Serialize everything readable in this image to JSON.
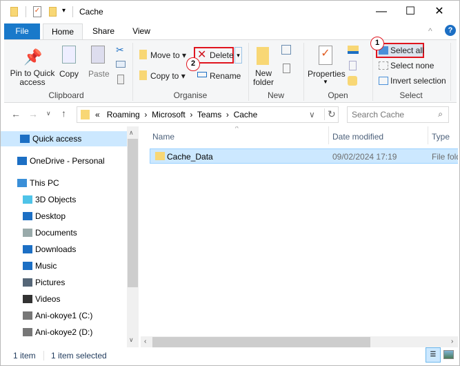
{
  "window": {
    "title": "Cache",
    "controls": [
      "minimize",
      "maximize",
      "close"
    ]
  },
  "tabs": [
    {
      "label": "File"
    },
    {
      "label": "Home"
    },
    {
      "label": "Share"
    },
    {
      "label": "View"
    }
  ],
  "ribbon": {
    "clipboard": {
      "label": "Clipboard",
      "pin": "Pin to Quick access",
      "copy": "Copy",
      "paste": "Paste"
    },
    "organise": {
      "label": "Organise",
      "move_to": "Move to",
      "copy_to": "Copy to",
      "delete": "Delete",
      "rename": "Rename"
    },
    "new": {
      "label": "New",
      "new_folder": "New folder"
    },
    "open": {
      "label": "Open",
      "properties": "Properties"
    },
    "select": {
      "label": "Select",
      "select_all": "Select all",
      "select_none": "Select none",
      "invert": "Invert selection"
    }
  },
  "annotations": [
    {
      "n": "1",
      "target": "Select all"
    },
    {
      "n": "2",
      "target": "Delete"
    }
  ],
  "address": {
    "breadcrumb": [
      "«",
      "Roaming",
      "Microsoft",
      "Teams",
      "Cache"
    ],
    "search_placeholder": "Search Cache"
  },
  "sidebar": {
    "items": [
      {
        "label": "Quick access",
        "icon": "star-icon",
        "selected": true
      },
      {
        "label": "OneDrive - Personal",
        "icon": "cloud-icon"
      },
      {
        "label": "This PC",
        "icon": "pc-icon"
      },
      {
        "label": "3D Objects",
        "icon": "cube-icon"
      },
      {
        "label": "Desktop",
        "icon": "desktop-icon"
      },
      {
        "label": "Documents",
        "icon": "document-icon"
      },
      {
        "label": "Downloads",
        "icon": "download-icon"
      },
      {
        "label": "Music",
        "icon": "music-icon"
      },
      {
        "label": "Pictures",
        "icon": "pictures-icon"
      },
      {
        "label": "Videos",
        "icon": "video-icon"
      },
      {
        "label": "Ani-okoye1 (C:)",
        "icon": "drive-icon"
      },
      {
        "label": "Ani-okoye2 (D:)",
        "icon": "drive-icon"
      }
    ]
  },
  "columns": [
    "Name",
    "Date modified",
    "Type"
  ],
  "files": [
    {
      "name": "Cache_Data",
      "date": "09/02/2024 17:19",
      "type": "File folder",
      "selected": true
    }
  ],
  "status": {
    "count": "1 item",
    "selected": "1 item selected"
  },
  "colors": {
    "accent": "#1979ca",
    "selection": "#cce8ff",
    "highlight": "#e0141e"
  }
}
